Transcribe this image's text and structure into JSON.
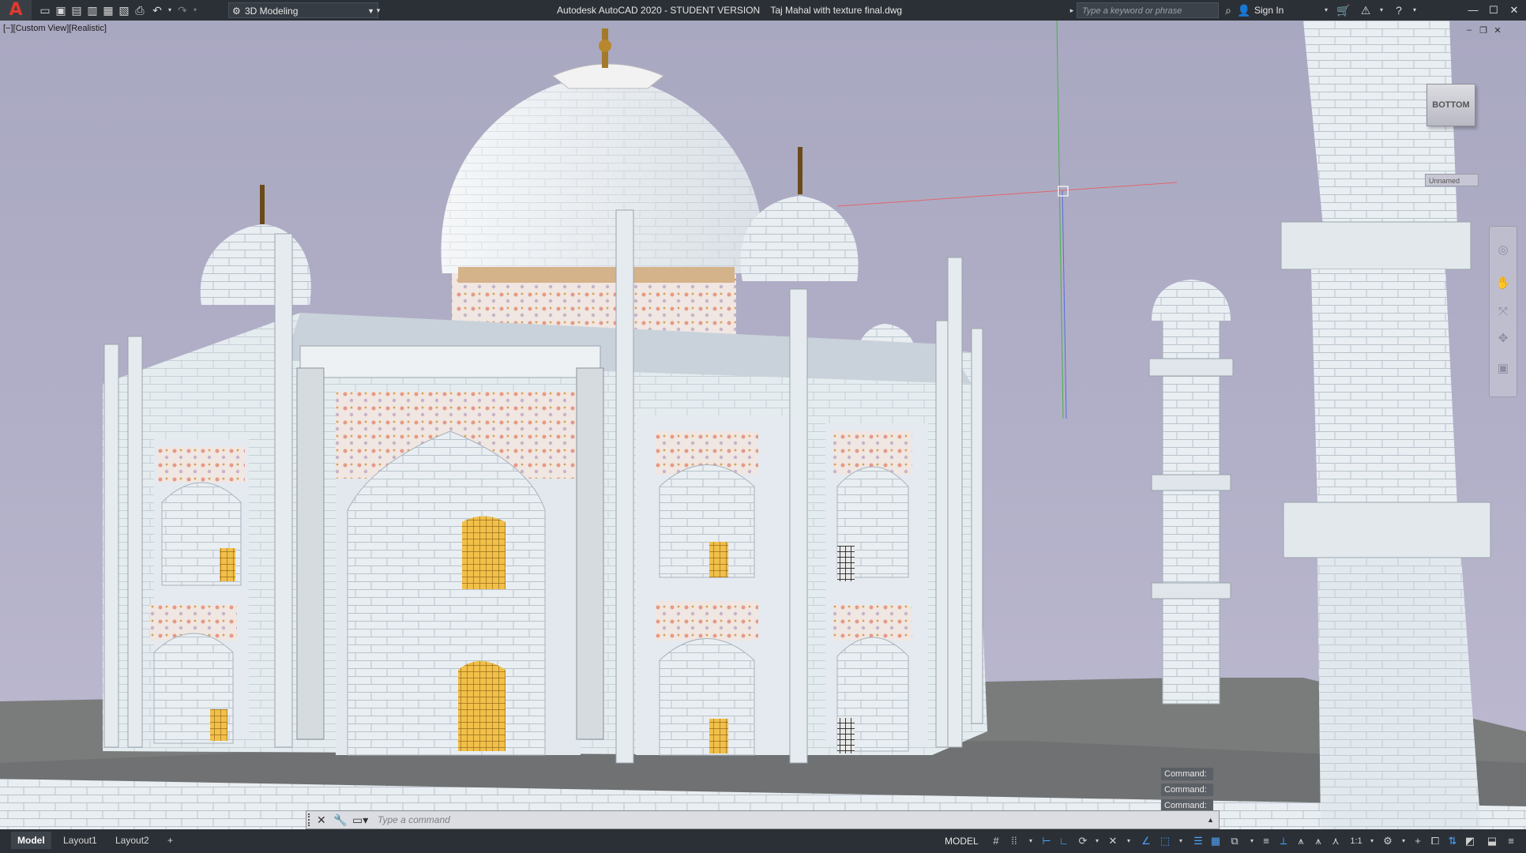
{
  "app": {
    "logo_letter": "A",
    "title": "Autodesk AutoCAD 2020 - STUDENT VERSION    Taj Mahal with texture final.dwg",
    "workspace": "3D Modeling",
    "search_placeholder": "Type a keyword or phrase",
    "sign_in": "Sign In"
  },
  "viewport": {
    "label": "[−][Custom View][Realistic]",
    "viewcube_face": "BOTTOM",
    "ucs_name": "Unnamed"
  },
  "command": {
    "history": [
      "Command:",
      "Command:",
      "Command:"
    ],
    "placeholder": "Type a command"
  },
  "tabs": [
    "Model",
    "Layout1",
    "Layout2"
  ],
  "status": {
    "space": "MODEL",
    "scale": "1:1"
  },
  "colors": {
    "accent": "#e03a2f",
    "sky": "#aeadc5",
    "ground": "#7b7d7d",
    "marble": "#e9edf1",
    "gold": "#e2a32c"
  }
}
